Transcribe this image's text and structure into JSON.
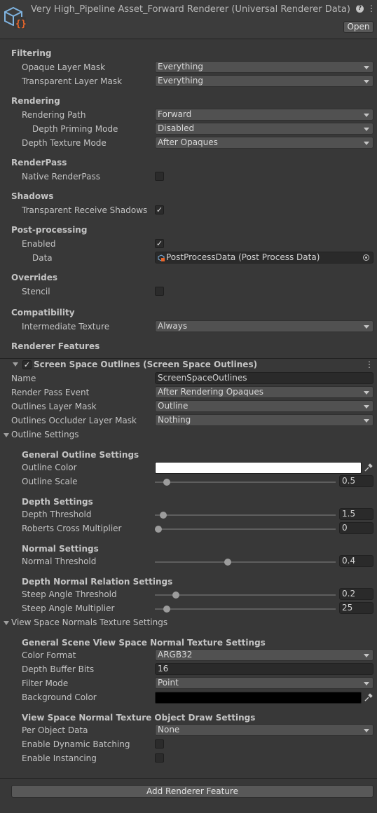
{
  "header": {
    "title": "Very High_Pipeline Asset_Forward Renderer (Universal Renderer Data)",
    "help_icon": "?",
    "menu_icon": "⋮",
    "open_label": "Open"
  },
  "filtering": {
    "title": "Filtering",
    "opaque_label": "Opaque Layer Mask",
    "opaque_value": "Everything",
    "transparent_label": "Transparent Layer Mask",
    "transparent_value": "Everything"
  },
  "rendering": {
    "title": "Rendering",
    "path_label": "Rendering Path",
    "path_value": "Forward",
    "depth_priming_label": "Depth Priming Mode",
    "depth_priming_value": "Disabled",
    "depth_texture_label": "Depth Texture Mode",
    "depth_texture_value": "After Opaques"
  },
  "renderpass": {
    "title": "RenderPass",
    "native_label": "Native RenderPass",
    "native_checked": false
  },
  "shadows": {
    "title": "Shadows",
    "receive_label": "Transparent Receive Shadows",
    "receive_checked": true
  },
  "postprocessing": {
    "title": "Post-processing",
    "enabled_label": "Enabled",
    "enabled_checked": true,
    "data_label": "Data",
    "data_value": "PostProcessData (Post Process Data)"
  },
  "overrides": {
    "title": "Overrides",
    "stencil_label": "Stencil",
    "stencil_checked": false
  },
  "compatibility": {
    "title": "Compatibility",
    "intermediate_label": "Intermediate Texture",
    "intermediate_value": "Always"
  },
  "renderer_features": {
    "title": "Renderer Features"
  },
  "feature": {
    "title": "Screen Space Outlines (Screen Space Outlines)",
    "enabled": true,
    "menu_icon": "⋮",
    "name_label": "Name",
    "name_value": "ScreenSpaceOutlines",
    "event_label": "Render Pass Event",
    "event_value": "After Rendering Opaques",
    "layer_label": "Outlines Layer Mask",
    "layer_value": "Outline",
    "occluder_label": "Outlines Occluder Layer Mask",
    "occluder_value": "Nothing"
  },
  "outline_settings": {
    "title": "Outline Settings",
    "general_title": "General Outline Settings",
    "color_label": "Outline Color",
    "color_value": "#ffffff",
    "scale_label": "Outline Scale",
    "scale_value": "0.5",
    "scale_fraction": 0.05,
    "depth_title": "Depth Settings",
    "depth_threshold_label": "Depth Threshold",
    "depth_threshold_value": "1.5",
    "depth_threshold_fraction": 0.03,
    "roberts_label": "Roberts Cross Multiplier",
    "roberts_value": "0",
    "roberts_fraction": 0.0,
    "normal_title": "Normal Settings",
    "normal_threshold_label": "Normal Threshold",
    "normal_threshold_value": "0.4",
    "normal_threshold_fraction": 0.4,
    "relation_title": "Depth Normal Relation Settings",
    "steep_threshold_label": "Steep Angle Threshold",
    "steep_threshold_value": "0.2",
    "steep_threshold_fraction": 0.1,
    "steep_multiplier_label": "Steep Angle Multiplier",
    "steep_multiplier_value": "25",
    "steep_multiplier_fraction": 0.05
  },
  "view_space": {
    "title": "View Space Normals Texture Settings",
    "general_title": "General Scene View Space Normal Texture Settings",
    "format_label": "Color Format",
    "format_value": "ARGB32",
    "depth_bits_label": "Depth Buffer Bits",
    "depth_bits_value": "16",
    "filter_label": "Filter Mode",
    "filter_value": "Point",
    "bg_label": "Background Color",
    "bg_value": "#000000",
    "draw_title": "View Space Normal Texture Object Draw Settings",
    "per_object_label": "Per Object Data",
    "per_object_value": "None",
    "dynamic_label": "Enable Dynamic Batching",
    "dynamic_checked": false,
    "instancing_label": "Enable Instancing",
    "instancing_checked": false
  },
  "add_feature_label": "Add Renderer Feature",
  "checkmark": "✓"
}
